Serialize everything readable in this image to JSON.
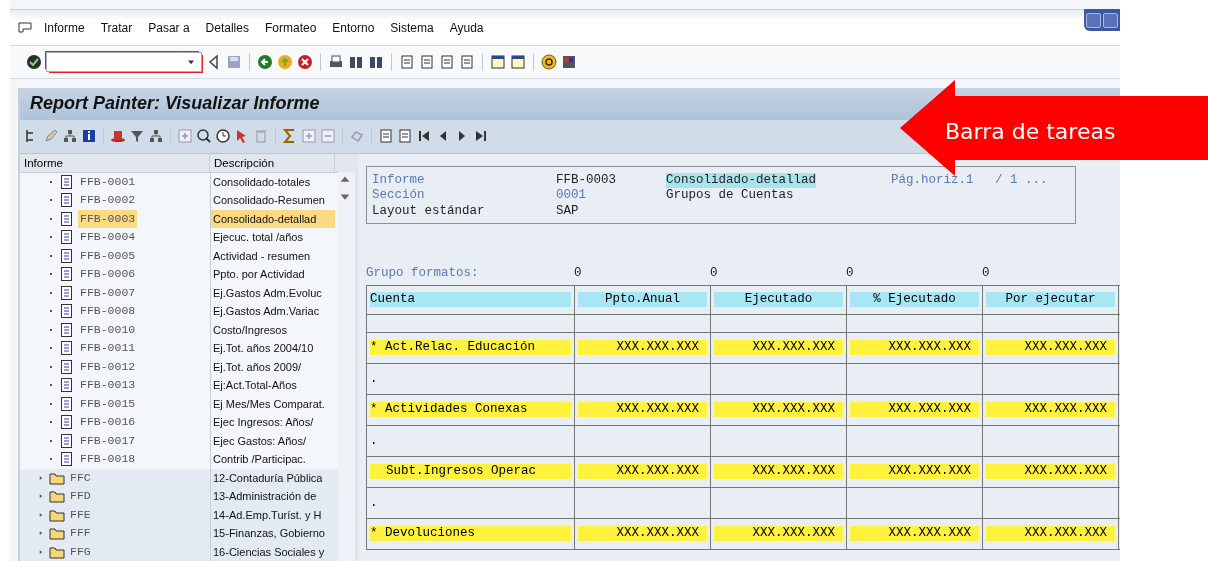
{
  "menu": [
    {
      "label": "Informe"
    },
    {
      "label": "Tratar"
    },
    {
      "label": "Pasar a"
    },
    {
      "label": "Detalles"
    },
    {
      "label": "Formateo"
    },
    {
      "label": "Entorno"
    },
    {
      "label": "Sistema"
    },
    {
      "label": "Ayuda"
    }
  ],
  "title": "Report Painter: Visualizar Informe",
  "tree": {
    "columns": [
      "Informe",
      "Descripción"
    ],
    "items": [
      {
        "kind": "report",
        "id": "FFB-0001",
        "description": "Consolidado-totales",
        "selected": false
      },
      {
        "kind": "report",
        "id": "FFB-0002",
        "description": "Consolidado-Resumen",
        "selected": false
      },
      {
        "kind": "report",
        "id": "FFB-0003",
        "description": "Consolidado-detallad",
        "selected": true
      },
      {
        "kind": "report",
        "id": "FFB-0004",
        "description": "Ejecuc. total /años",
        "selected": false
      },
      {
        "kind": "report",
        "id": "FFB-0005",
        "description": "Actividad - resumen",
        "selected": false
      },
      {
        "kind": "report",
        "id": "FFB-0006",
        "description": "Ppto. por Actividad",
        "selected": false
      },
      {
        "kind": "report",
        "id": "FFB-0007",
        "description": "Ej.Gastos Adm.Evoluc",
        "selected": false
      },
      {
        "kind": "report",
        "id": "FFB-0008",
        "description": "Ej.Gastos Adm.Variac",
        "selected": false
      },
      {
        "kind": "report",
        "id": "FFB-0010",
        "description": "Costo/Ingresos",
        "selected": false
      },
      {
        "kind": "report",
        "id": "FFB-0011",
        "description": "Ej.Tot. años 2004/10",
        "selected": false
      },
      {
        "kind": "report",
        "id": "FFB-0012",
        "description": "Ej.Tot. años 2009/",
        "selected": false
      },
      {
        "kind": "report",
        "id": "FFB-0013",
        "description": "Ej:Act.Total-Años",
        "selected": false
      },
      {
        "kind": "report",
        "id": "FFB-0015",
        "description": "Ej Mes/Mes Comparat.",
        "selected": false
      },
      {
        "kind": "report",
        "id": "FFB-0016",
        "description": "Ejec Ingresos: Años/",
        "selected": false
      },
      {
        "kind": "report",
        "id": "FFB-0017",
        "description": "Ejec Gastos: Años/",
        "selected": false
      },
      {
        "kind": "report",
        "id": "FFB-0018",
        "description": "Contrib /Participac.",
        "selected": false
      },
      {
        "kind": "folder",
        "id": "FFC",
        "description": "12-Contaduría Pública",
        "selected": false,
        "expanded": false
      },
      {
        "kind": "folder",
        "id": "FFD",
        "description": "13-Administración de",
        "selected": false,
        "expanded": false
      },
      {
        "kind": "folder",
        "id": "FFE",
        "description": "14-Ad.Emp.Turíst. y H",
        "selected": false,
        "expanded": false
      },
      {
        "kind": "folder",
        "id": "FFF",
        "description": "15-Finanzas, Gobierno",
        "selected": false,
        "expanded": false
      },
      {
        "kind": "folder",
        "id": "FFG",
        "description": "16-Ciencias Sociales y",
        "selected": false,
        "expanded": false
      }
    ]
  },
  "header": {
    "rows": [
      {
        "label": "Informe",
        "value": "FFB-0003",
        "text": "Consolidado-detallad",
        "page": "Pág.horiz.1",
        "page_total": "/ 1 ..."
      },
      {
        "label": "Sección",
        "value": "0001",
        "text": "Grupos de Cuentas"
      },
      {
        "label": "Layout estándar",
        "value": "SAP"
      }
    ]
  },
  "format_group": {
    "label": "Grupo formatos:",
    "values": [
      "0",
      "0",
      "0",
      "0"
    ]
  },
  "table": {
    "columns": [
      "Cuenta",
      "Ppto.Anual",
      "Ejecutado",
      "% Ejecutado",
      "Por ejecutar"
    ],
    "rows": [
      {
        "kind": "total",
        "label": "* Act.Relac. Educación",
        "values": [
          "XXX.XXX.XXX",
          "XXX.XXX.XXX",
          "XXX.XXX.XXX",
          "XXX.XXX.XXX"
        ]
      },
      {
        "kind": "dot",
        "label": "."
      },
      {
        "kind": "total",
        "label": "* Actividades Conexas",
        "values": [
          "XXX.XXX.XXX",
          "XXX.XXX.XXX",
          "XXX.XXX.XXX",
          "XXX.XXX.XXX"
        ]
      },
      {
        "kind": "dot",
        "label": "."
      },
      {
        "kind": "subtotal",
        "label": "Subt.Ingresos Operac",
        "values": [
          "XXX.XXX.XXX",
          "XXX.XXX.XXX",
          "XXX.XXX.XXX",
          "XXX.XXX.XXX"
        ]
      },
      {
        "kind": "dot",
        "label": "."
      },
      {
        "kind": "total",
        "label": "* Devoluciones",
        "values": [
          "XXX.XXX.XXX",
          "XXX.XXX.XXX",
          "XXX.XXX.XXX",
          "XXX.XXX.XXX"
        ]
      }
    ]
  },
  "annotation": {
    "text": "Barra de tareas"
  }
}
